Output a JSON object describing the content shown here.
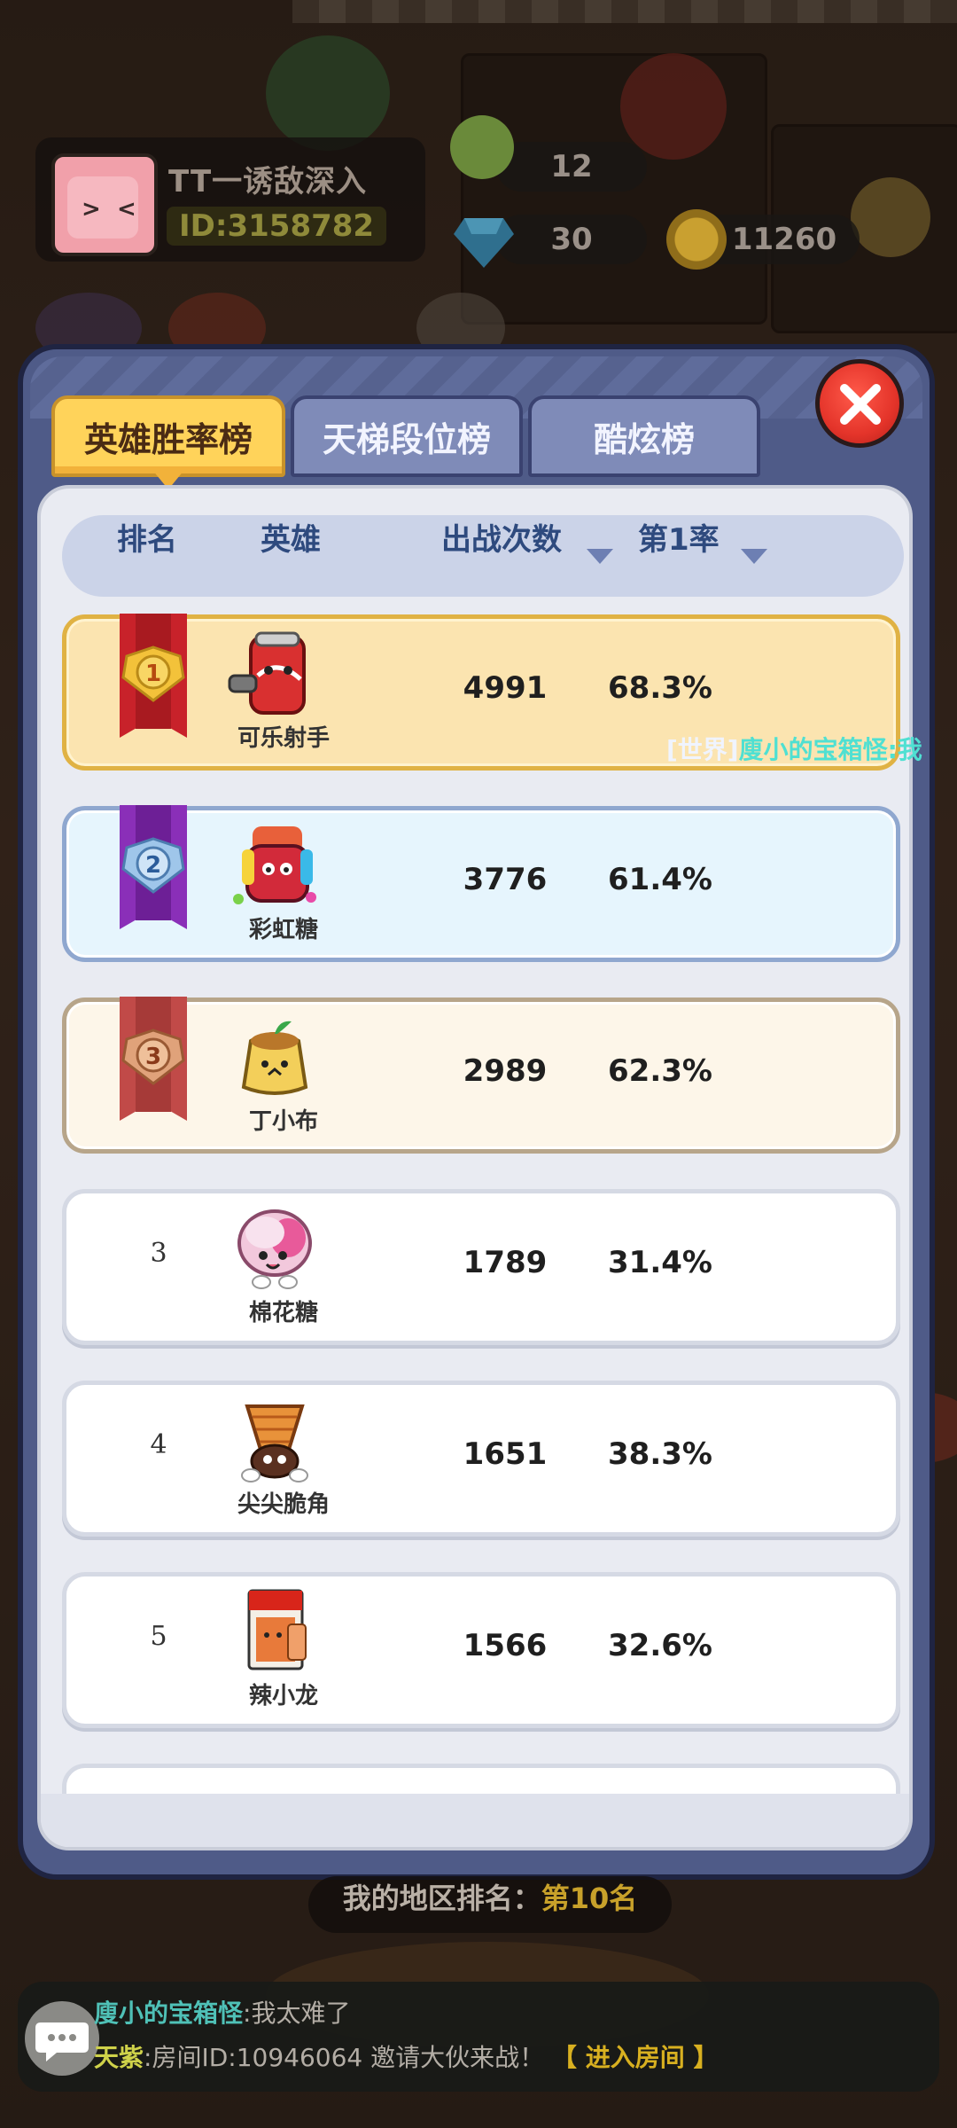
{
  "player": {
    "name": "TT一诱敌深入",
    "id": "ID:3158782"
  },
  "resources": {
    "energy": "12",
    "gems": "30",
    "coins": "11260"
  },
  "tabs": [
    "英雄胜率榜",
    "天梯段位榜",
    "酷炫榜"
  ],
  "active_tab": "英雄胜率榜",
  "columns": {
    "rank": "排名",
    "hero": "英雄",
    "games": "出战次数",
    "first_rate": "第1率"
  },
  "rows": [
    {
      "medal": "gold-medal-1",
      "hero": "可乐射手",
      "games": "4991",
      "rate": "68.3%"
    },
    {
      "medal": "silver-medal-2",
      "hero": "彩虹糖",
      "games": "3776",
      "rate": "61.4%"
    },
    {
      "medal": "bronze-medal-3",
      "hero": "丁小布",
      "games": "2989",
      "rate": "62.3%"
    },
    {
      "rank": "3",
      "hero": "棉花糖",
      "games": "1789",
      "rate": "31.4%"
    },
    {
      "rank": "4",
      "hero": "尖尖脆角",
      "games": "1651",
      "rate": "38.3%"
    },
    {
      "rank": "5",
      "hero": "辣小龙",
      "games": "1566",
      "rate": "32.6%"
    }
  ],
  "world_chat_ticker": {
    "tag": "[世界]",
    "who": "廋小的宝箱怪:我"
  },
  "my_rank": {
    "label": "我的地区排名：",
    "value": "第10名"
  },
  "chat": [
    {
      "speaker": "廋小的宝箱怪",
      "message": ":我太难了"
    },
    {
      "speaker": "天紫",
      "message": ":房间ID:10946064 邀请大伙来战！",
      "link": "【 进入房间 】"
    }
  ],
  "colors": {
    "panel": "#4f5b88",
    "active_tab": "#ffd35a",
    "close": "#e4342a",
    "header_text": "#2e4a7e"
  },
  "icons": [
    "close-icon",
    "gem-icon",
    "coin-icon",
    "energy-icon",
    "chat-bubble-icon",
    "sort-down-icon"
  ]
}
